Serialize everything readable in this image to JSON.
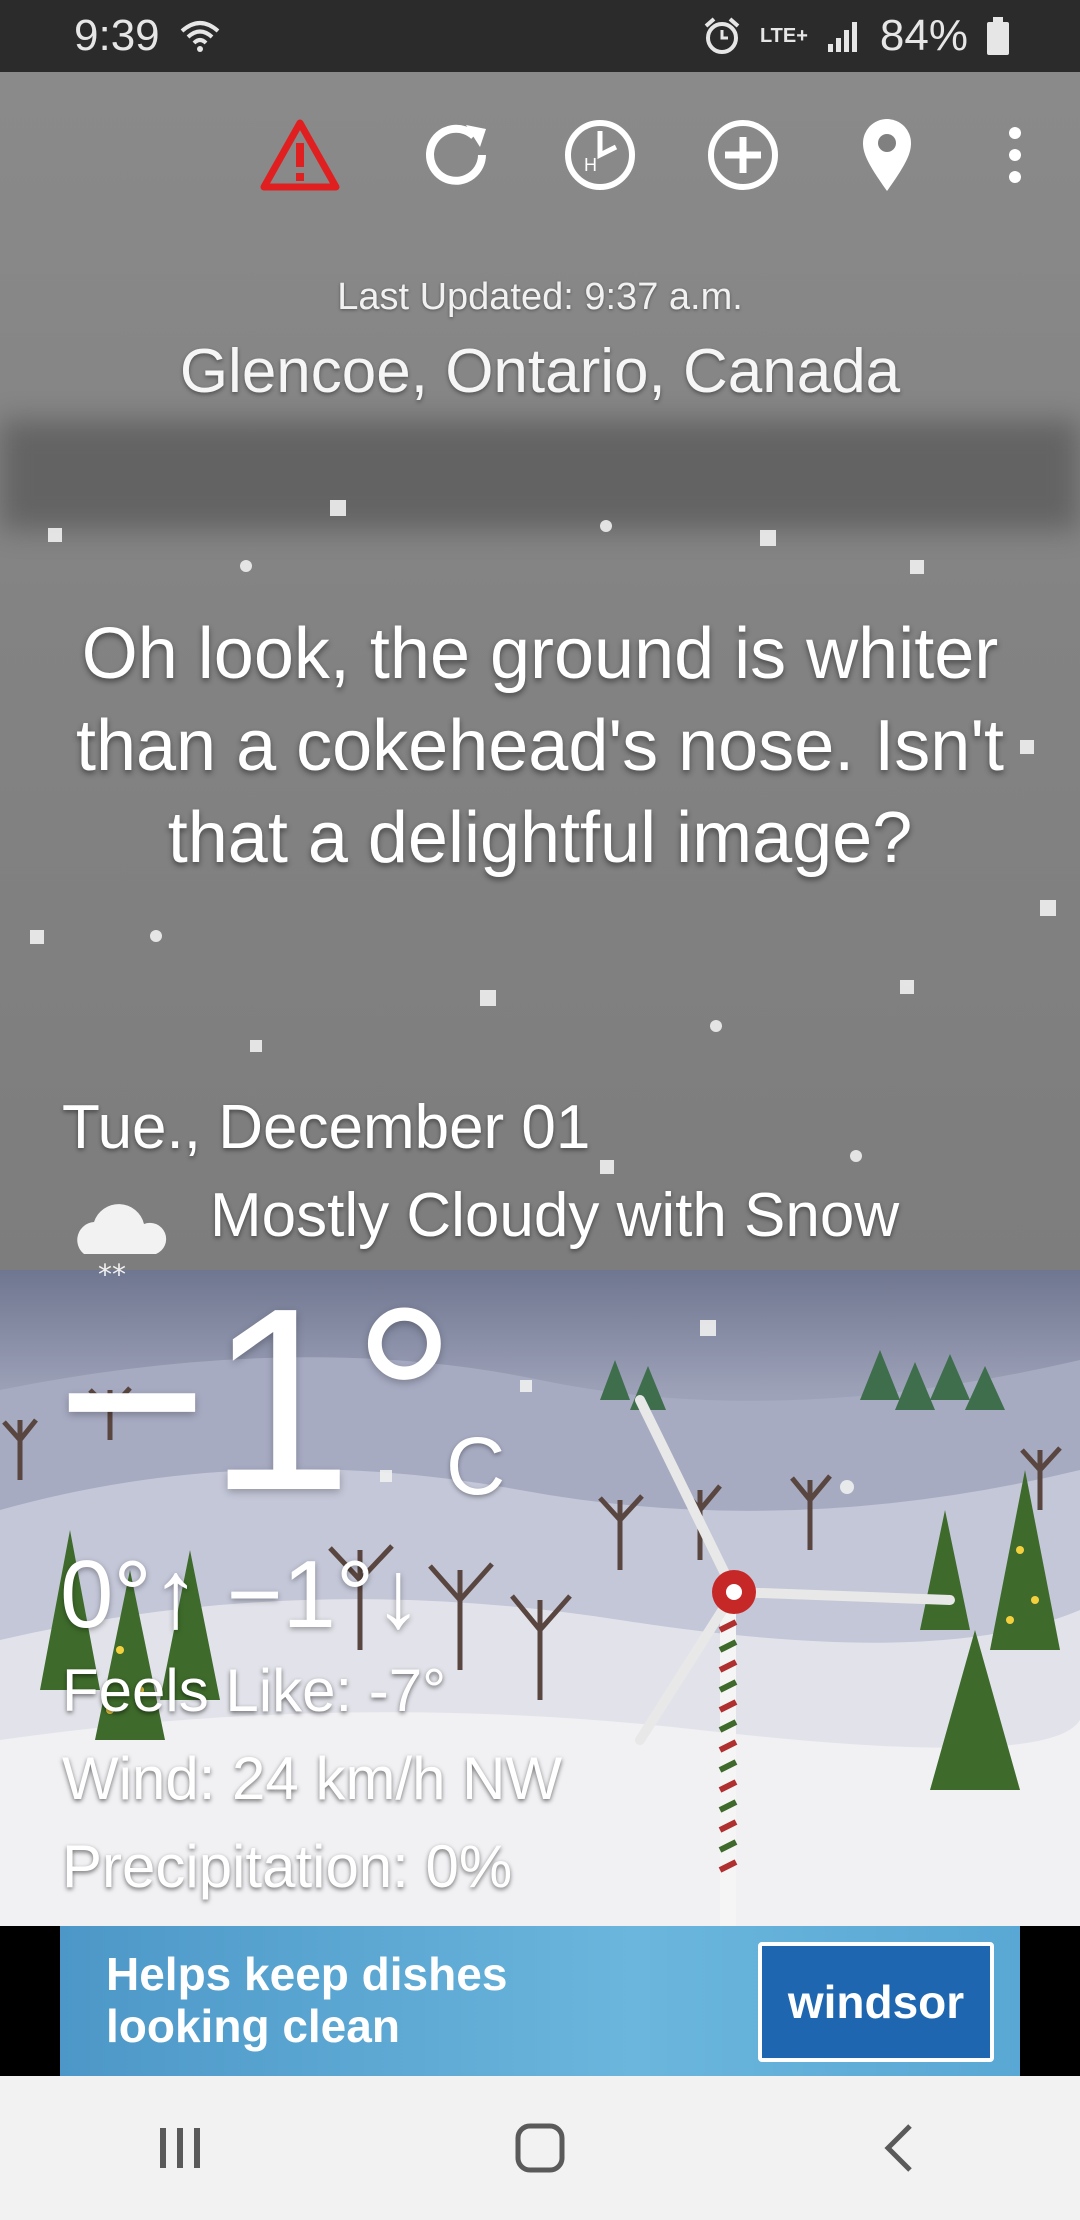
{
  "status_bar": {
    "time": "9:39",
    "battery": "84%",
    "network": "LTE+",
    "icons": [
      "wifi-icon",
      "alarm-icon",
      "lte-icon",
      "signal-icon",
      "battery-icon"
    ]
  },
  "toolbar": {
    "buttons": [
      "alert-icon",
      "refresh-icon",
      "hourly-icon",
      "add-location-icon",
      "location-pin-icon",
      "overflow-menu-icon"
    ],
    "alert_color": "#e02020"
  },
  "header": {
    "last_updated": "Last Updated: 9:37 a.m.",
    "location": "Glencoe, Ontario, Canada"
  },
  "commentary": "Oh look, the ground is whiter than a cokehead's nose. Isn't that a delightful image?",
  "forecast": {
    "date": "Tue., December 01",
    "condition": "Mostly Cloudy with Snow",
    "condition_icon": "cloud-snow-icon",
    "temperature": "−1°",
    "unit": "C",
    "high_low": "0°↑ −1°↓",
    "feels_like": "Feels Like: -7°",
    "wind": "Wind: 24 km/h NW",
    "precipitation": "Precipitation: 0%"
  },
  "ad": {
    "headline_line1": "Helps keep dishes",
    "headline_line2": "looking clean",
    "brand": "windsor"
  },
  "nav_bar": {
    "buttons": [
      "recents-icon",
      "home-icon",
      "back-icon"
    ]
  }
}
